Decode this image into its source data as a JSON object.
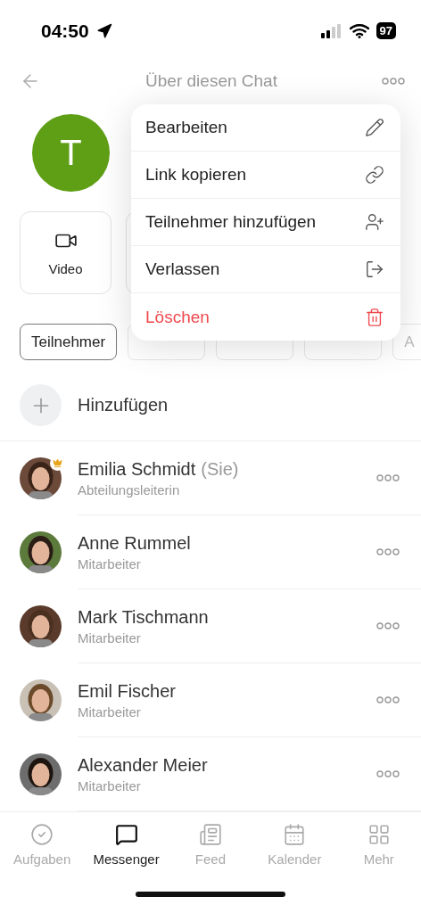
{
  "status_bar": {
    "time": "04:50",
    "battery": "97"
  },
  "header": {
    "title": "Über diesen Chat"
  },
  "chat": {
    "avatar_letter": "T"
  },
  "actions": [
    {
      "label": "Video"
    }
  ],
  "tabs": [
    {
      "label": "Teilnehmer",
      "selected": true
    },
    {
      "selected": false
    },
    {
      "selected": false
    },
    {
      "selected": false
    },
    {
      "label": "A",
      "selected": false
    }
  ],
  "add_row": {
    "label": "Hinzufügen"
  },
  "members": [
    {
      "name": "Emilia Schmidt",
      "suffix": "(Sie)",
      "role": "Abteilungsleiterin",
      "admin": true
    },
    {
      "name": "Anne Rummel",
      "role": "Mitarbeiter",
      "admin": false
    },
    {
      "name": "Mark Tischmann",
      "role": "Mitarbeiter",
      "admin": false
    },
    {
      "name": "Emil Fischer",
      "role": "Mitarbeiter",
      "admin": false
    },
    {
      "name": "Alexander Meier",
      "role": "Mitarbeiter",
      "admin": false
    }
  ],
  "menu": [
    {
      "label": "Bearbeiten",
      "kind": "edit",
      "danger": false
    },
    {
      "label": "Link kopieren",
      "kind": "link",
      "danger": false
    },
    {
      "label": "Teilnehmer hinzufügen",
      "kind": "add-user",
      "danger": false
    },
    {
      "label": "Verlassen",
      "kind": "leave",
      "danger": false
    },
    {
      "label": "Löschen",
      "kind": "delete",
      "danger": true
    }
  ],
  "nav": [
    {
      "label": "Aufgaben",
      "kind": "tasks",
      "selected": false
    },
    {
      "label": "Messenger",
      "kind": "messenger",
      "selected": true
    },
    {
      "label": "Feed",
      "kind": "feed",
      "selected": false
    },
    {
      "label": "Kalender",
      "kind": "calendar",
      "selected": false
    },
    {
      "label": "Mehr",
      "kind": "more",
      "selected": false
    }
  ]
}
